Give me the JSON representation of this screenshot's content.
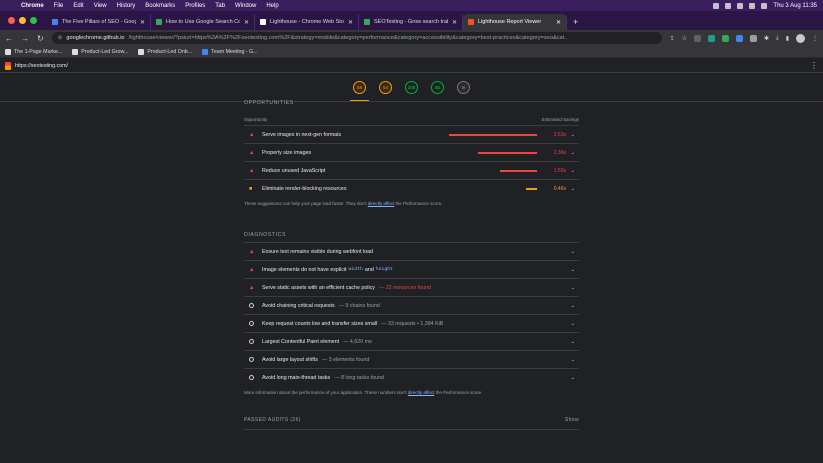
{
  "menubar": {
    "app": "Chrome",
    "items": [
      "File",
      "Edit",
      "View",
      "History",
      "Bookmarks",
      "Profiles",
      "Tab",
      "Window",
      "Help"
    ],
    "clock": "Thu 3 Aug  11:35"
  },
  "tabs": [
    {
      "label": "The Five Pillars of SEO - Goog",
      "color": "#4285f4"
    },
    {
      "label": "How to Use Google Search Co",
      "color": "#34a853"
    },
    {
      "label": "Lighthouse - Chrome Web Sto",
      "color": "#ffffff"
    },
    {
      "label": "SEOTesting - Grow search traf",
      "color": "#34a853"
    },
    {
      "label": "Lighthouse Report Viewer",
      "color": "#f4511e",
      "active": true
    }
  ],
  "omnibox": {
    "host": "googlechrome.github.io",
    "path": "/lighthouse/viewer/?psiurl=https%3A%2F%2Fseotesting.com%2F&strategy=mobile&category=performance&category=accessibility&category=best-practices&category=seo&cat..."
  },
  "bookmarks": [
    "The 1-Page Marke...",
    "Product-Led Grow...",
    "Product-Led Onb...",
    "Team Meeting - G..."
  ],
  "lighthouse": {
    "url": "https://seotesting.com/",
    "scores": [
      {
        "value": "58",
        "kind": "orange",
        "active": true
      },
      {
        "value": "54",
        "kind": "orange"
      },
      {
        "value": "100",
        "kind": "green"
      },
      {
        "value": "92",
        "kind": "green"
      },
      {
        "value": "",
        "kind": "pwa"
      }
    ]
  },
  "opportunities": {
    "title": "OPPORTUNITIES",
    "col_left": "Opportunity",
    "col_right": "Estimated Savings",
    "items": [
      {
        "title": "Serve images in next-gen formats",
        "saving": "3.53s",
        "level": "fail",
        "fraction": 1.0
      },
      {
        "title": "Properly size images",
        "saving": "2.36s",
        "level": "fail",
        "fraction": 0.67
      },
      {
        "title": "Reduce unused JavaScript",
        "saving": "1.50s",
        "level": "fail",
        "fraction": 0.42
      },
      {
        "title": "Eliminate render-blocking resources",
        "saving": "0.46s",
        "level": "average",
        "fraction": 0.13
      }
    ],
    "note_prefix": "These suggestions can help your page load faster. They don't ",
    "note_link": "directly affect",
    "note_suffix": " the Performance score."
  },
  "diagnostics": {
    "title": "DIAGNOSTICS",
    "items": [
      {
        "level": "fail",
        "title": "Ensure text remains visible during webfont load"
      },
      {
        "level": "fail",
        "title": "Image elements do not have explicit",
        "code1": "width",
        "and": "and",
        "code2": "height"
      },
      {
        "level": "fail",
        "title": "Serve static assets with an efficient cache policy",
        "extra": "— 22 resources found",
        "extra_red": true
      },
      {
        "level": "info",
        "title": "Avoid chaining critical requests",
        "extra": "— 9 chains found"
      },
      {
        "level": "info",
        "title": "Keep request counts low and transfer sizes small",
        "extra": "— 33 requests • 1,384 KiB"
      },
      {
        "level": "info",
        "title": "Largest Contentful Paint element",
        "extra": "— 4,620 ms"
      },
      {
        "level": "info",
        "title": "Avoid large layout shifts",
        "extra": "— 3 elements found"
      },
      {
        "level": "info",
        "title": "Avoid long main-thread tasks",
        "extra": "— 8 long tasks found"
      }
    ],
    "note_prefix": "More information about the performance of your application. These numbers don't ",
    "note_link": "directly affect",
    "note_suffix": " the Performance score."
  },
  "passed": {
    "label": "PASSED AUDITS (26)",
    "toggle": "Show"
  }
}
